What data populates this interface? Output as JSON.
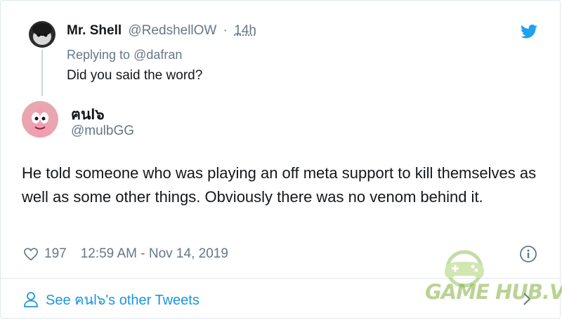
{
  "parent_tweet": {
    "name": "Mr. Shell",
    "handle": "@RedshellOW",
    "separator": "·",
    "time_ago": "14h",
    "replying_prefix": "Replying to",
    "replying_to": "@dafran",
    "text": "Did you said the word?"
  },
  "main_tweet": {
    "name": "ฅนl๖",
    "handle": "@mulbGG",
    "text": "He told someone who was playing an off meta support to kill themselves as well as some other things. Obviously there was no venom behind it.",
    "like_count": "197",
    "timestamp": "12:59 AM - Nov 14, 2019"
  },
  "footer": {
    "see_more": "See ฅนl๖'s other Tweets"
  },
  "watermark": {
    "text": "GAME HUB.VN"
  },
  "colors": {
    "accent": "#1da1f2",
    "link": "#1b95e0",
    "muted": "#657786",
    "text": "#14171a",
    "border": "#e1e8ed"
  },
  "icons": [
    "twitter-bird-icon",
    "heart-icon",
    "info-icon",
    "person-icon",
    "chevron-right-icon",
    "gamepad-logo-icon"
  ]
}
